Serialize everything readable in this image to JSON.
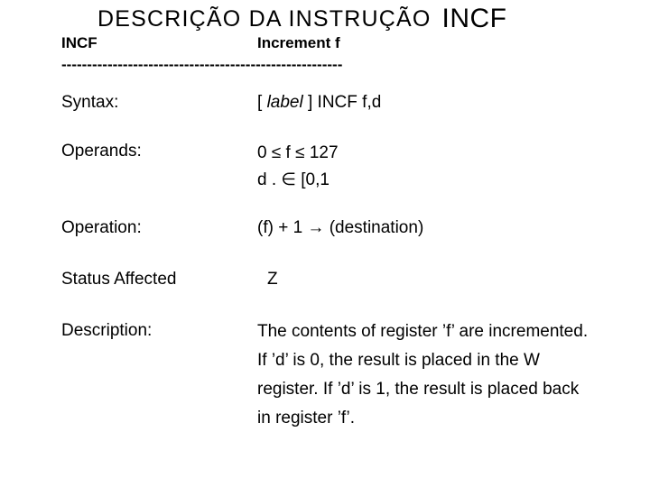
{
  "slide": {
    "title": {
      "main": "DESCRIÇÃO  DA  INSTRUÇÃO",
      "suffix": "INCF"
    },
    "header": {
      "mnemonic": "INCF",
      "description": "Increment f"
    },
    "separator": "-------------------------------------------------------",
    "rows": [
      {
        "label": "Syntax:",
        "value_prefix": "[ ",
        "value_italic": "label",
        "value_suffix": " ] INCF f,d",
        "value": "[ label ] INCF f,d"
      },
      {
        "label": "Operands:",
        "value": "0 ≤ f ≤ 127\nd . ∈ [0,1"
      },
      {
        "label": "Operation:",
        "value": "(f) + 1 → (destination)"
      },
      {
        "label": "Status Affected",
        "value": "Z"
      },
      {
        "label": "Description:",
        "value": "The contents of register ’f’ are incremented. If ’d’ is 0, the result is placed in the W register. If ’d’ is 1, the result is placed back in register ’f’."
      }
    ]
  },
  "colors": {
    "background": "#ffffff",
    "text": "#000000"
  }
}
